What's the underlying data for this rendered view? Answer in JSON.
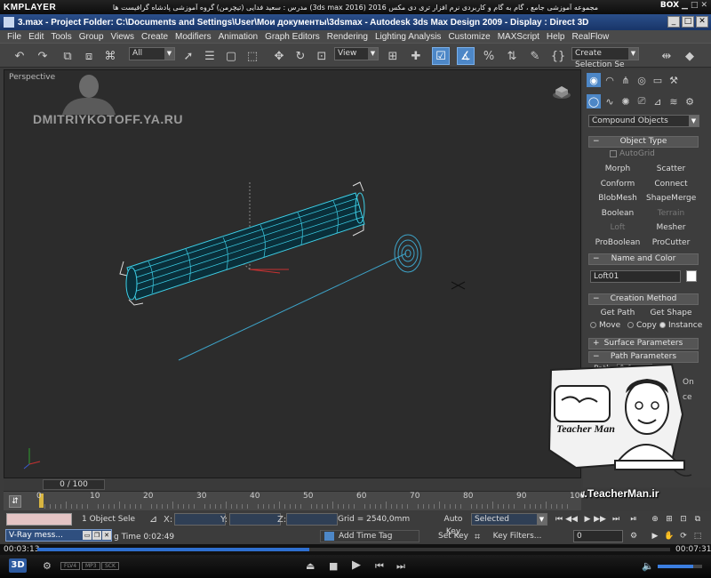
{
  "player": {
    "logo": "KMPLAYER",
    "title": "مجموعه آموزشی جامع ، گام به گام و کاربردی نرم افزار تری دی مکس 2016 (3ds max 2016) مدرس : سعید فدایی (تیچرمن) گروه آموزشی پادشاه گرافیست ها",
    "box_label": "BOX",
    "elapsed": "00:03:13",
    "total": "00:07:31",
    "progress_fraction": 0.43,
    "badges": [
      "FLV4",
      "MP3",
      "SCK"
    ],
    "badge_3d": "3D",
    "volume_fraction": 0.8
  },
  "window": {
    "title": "3.max   - Project Folder: C:\\Documents and Settings\\User\\Мои документы\\3dsmax   - Autodesk 3ds Max Design 2009      - Display : Direct 3D"
  },
  "menu": [
    "File",
    "Edit",
    "Tools",
    "Group",
    "Views",
    "Create",
    "Modifiers",
    "Animation",
    "Graph Editors",
    "Rendering",
    "Lighting Analysis",
    "Customize",
    "MAXScript",
    "Help",
    "RealFlow"
  ],
  "toolbar": {
    "filter": "All",
    "ref_coord": "View",
    "selection_set": "Create Selection Se"
  },
  "viewport": {
    "label": "Perspective",
    "watermark": "DMITRIYKOTOFF.YA.RU"
  },
  "command_panel": {
    "category": "Compound Objects",
    "object_type_header": "Object Type",
    "autogrid": "AutoGrid",
    "buttons": [
      {
        "label": "Morph",
        "enabled": true
      },
      {
        "label": "Scatter",
        "enabled": true
      },
      {
        "label": "Conform",
        "enabled": true
      },
      {
        "label": "Connect",
        "enabled": true
      },
      {
        "label": "BlobMesh",
        "enabled": true
      },
      {
        "label": "ShapeMerge",
        "enabled": true
      },
      {
        "label": "Boolean",
        "enabled": true
      },
      {
        "label": "Terrain",
        "enabled": false
      },
      {
        "label": "Loft",
        "enabled": false
      },
      {
        "label": "Mesher",
        "enabled": true
      },
      {
        "label": "ProBoolean",
        "enabled": true
      },
      {
        "label": "ProCutter",
        "enabled": true
      }
    ],
    "name_color_header": "Name and Color",
    "object_name": "Loft01",
    "creation_method_header": "Creation Method",
    "get_path": "Get Path",
    "get_shape": "Get Shape",
    "move": "Move",
    "copy": "Copy",
    "instance": "Instance",
    "surface_params_header": "Surface Parameters",
    "path_params_header": "Path Parameters",
    "path_label": "Path:",
    "path_value": "0,0",
    "on_label": "On",
    "ce_label": "ce"
  },
  "overlay": {
    "brand": "Teacher Man",
    "url": "www.TeacherMan.ir"
  },
  "timeline": {
    "slider": "0 / 100",
    "ticks": [
      "0",
      "10",
      "20",
      "30",
      "40",
      "50",
      "60",
      "70",
      "80",
      "90",
      "100"
    ]
  },
  "status": {
    "objects": "1 Object Sele",
    "x_label": "X:",
    "y_label": "Y:",
    "z_label": "Z:",
    "grid": "Grid = 2540,0mm",
    "vray": "V-Ray mess...",
    "render_time": "g Time  0:02:49",
    "add_time_tag": "Add Time Tag",
    "auto_key": "Auto Key",
    "selected": "Selected",
    "set_key": "Set Key",
    "key_filters": "Key Filters...",
    "frame": "0"
  }
}
